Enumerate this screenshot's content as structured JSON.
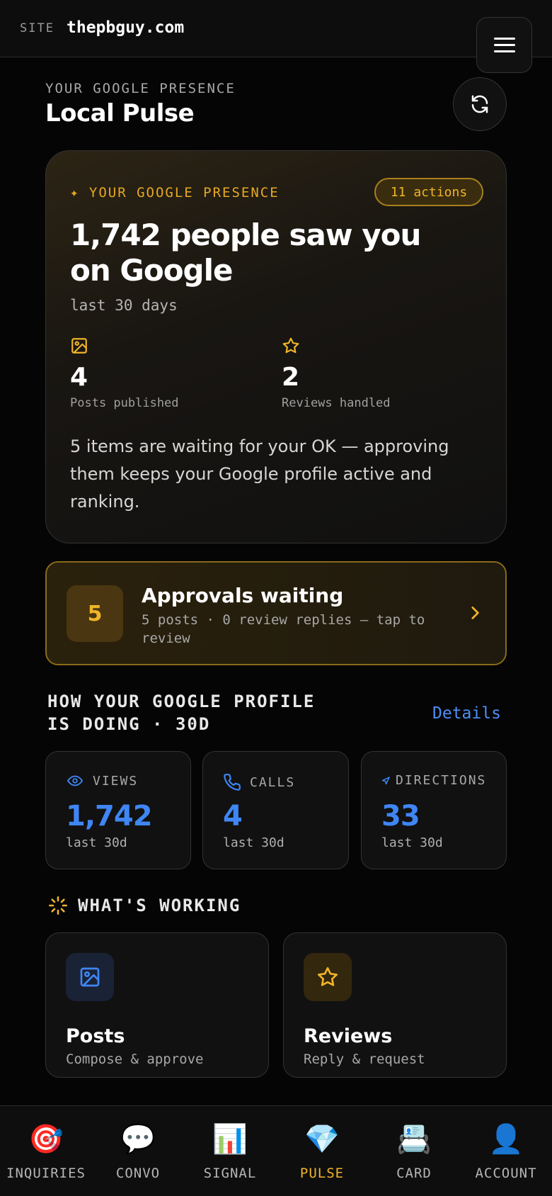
{
  "topbar": {
    "site_label": "SITE",
    "site_domain": "thepbguy.com",
    "menu_icon": "hamburger-menu-icon"
  },
  "header": {
    "eyebrow": "YOUR GOOGLE PRESENCE",
    "title": "Local Pulse",
    "refresh_icon": "refresh-icon"
  },
  "hero": {
    "eyebrow": "✦ YOUR GOOGLE PRESENCE",
    "badge": "11 actions",
    "headline": "1,742 people saw you on Google",
    "subtitle": "last 30 days",
    "stats": [
      {
        "icon": "image-icon",
        "value": "4",
        "label": "Posts published"
      },
      {
        "icon": "star-icon",
        "value": "2",
        "label": "Reviews handled"
      }
    ],
    "note": "5 items are waiting for your OK — approving them keeps your Google profile active and ranking."
  },
  "approvals": {
    "count": "5",
    "title": "Approvals waiting",
    "description": "5 posts · 0 review replies — tap to review"
  },
  "performance": {
    "title": "HOW YOUR GOOGLE PROFILE IS DOING · 30D",
    "details_label": "Details",
    "metrics": [
      {
        "icon": "eye-icon",
        "label": "VIEWS",
        "value": "1,742",
        "sub": "last 30d"
      },
      {
        "icon": "phone-icon",
        "label": "CALLS",
        "value": "4",
        "sub": "last 30d"
      },
      {
        "icon": "navigation-arrow-icon",
        "label": "DIRECTIONS",
        "value": "33",
        "sub": "last 30d"
      }
    ]
  },
  "working": {
    "title": "WHAT'S WORKING",
    "tiles": [
      {
        "icon": "image-icon",
        "title": "Posts",
        "subtitle": "Compose & approve"
      },
      {
        "icon": "star-icon",
        "title": "Reviews",
        "subtitle": "Reply & request"
      }
    ]
  },
  "nav": {
    "items": [
      {
        "emoji": "🎯",
        "label": "INQUIRIES"
      },
      {
        "emoji": "💬",
        "label": "CONVO"
      },
      {
        "emoji": "📊",
        "label": "SIGNAL"
      },
      {
        "emoji": "💎",
        "label": "PULSE"
      },
      {
        "emoji": "📇",
        "label": "CARD"
      },
      {
        "emoji": "👤",
        "label": "ACCOUNT"
      }
    ],
    "active": "PULSE"
  },
  "colors": {
    "accent_gold": "#f0b429",
    "accent_blue": "#3f86f4",
    "background": "#050505"
  }
}
